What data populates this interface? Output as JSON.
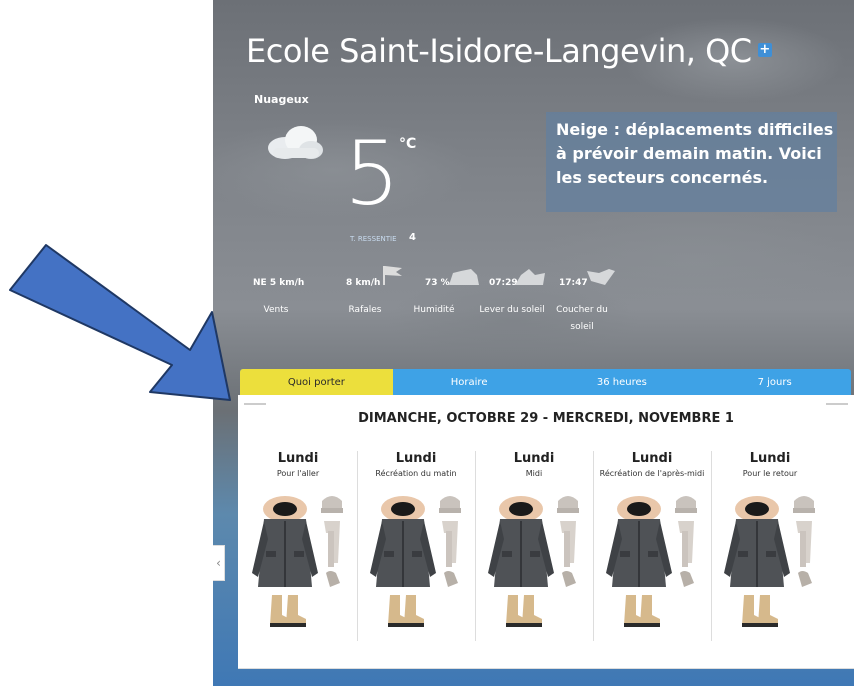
{
  "location": {
    "name": "Ecole Saint-Isidore-Langevin, QC",
    "add_icon": "plus-icon"
  },
  "current": {
    "condition": "Nuageux",
    "icon": "cloud-icon",
    "temperature": "5",
    "unit": "°C",
    "feels_like_label": "T. RESSENTIE",
    "feels_like_value": "4"
  },
  "alert": {
    "text": "Neige : déplacements difficiles à prévoir demain matin. Voici les secteurs concernés."
  },
  "stats": [
    {
      "value": "NE 5 km/h",
      "label": "Vents"
    },
    {
      "value": "8 km/h",
      "label": "Rafales",
      "icon": "flag-icon"
    },
    {
      "value": "73 %",
      "label": "Humidité",
      "icon": "flag-icon"
    },
    {
      "value": "07:29",
      "label": "Lever du soleil",
      "icon": "sunrise-icon"
    },
    {
      "value": "17:47",
      "label": "Coucher du soleil",
      "icon": "sunset-icon"
    }
  ],
  "tabs": [
    {
      "label": "Quoi porter",
      "active": true
    },
    {
      "label": "Horaire",
      "active": false
    },
    {
      "label": "36 heures",
      "active": false
    },
    {
      "label": "7 jours",
      "active": false
    }
  ],
  "what_to_wear": {
    "date_range": "DIMANCHE, OCTOBRE 29 - MERCREDI, NOVEMBRE 1",
    "columns": [
      {
        "day": "Lundi",
        "period": "Pour l'aller"
      },
      {
        "day": "Lundi",
        "period": "Récréation du matin"
      },
      {
        "day": "Lundi",
        "period": "Midi"
      },
      {
        "day": "Lundi",
        "period": "Récréation de l'après-midi"
      },
      {
        "day": "Lundi",
        "period": "Pour le retour"
      }
    ],
    "items": [
      "parka-icon",
      "tuque-icon",
      "scarf-icon",
      "mitten-icon",
      "boots-icon"
    ]
  },
  "nav": {
    "prev_icon": "chevron-left-icon",
    "prev_glyph": "‹"
  },
  "colors": {
    "tab_bar": "#3ea2e6",
    "tab_active": "#ecdf3c",
    "alert_bg": "#6280a0",
    "arrow": "#4472c4",
    "arrow_stroke": "#1f3864"
  }
}
